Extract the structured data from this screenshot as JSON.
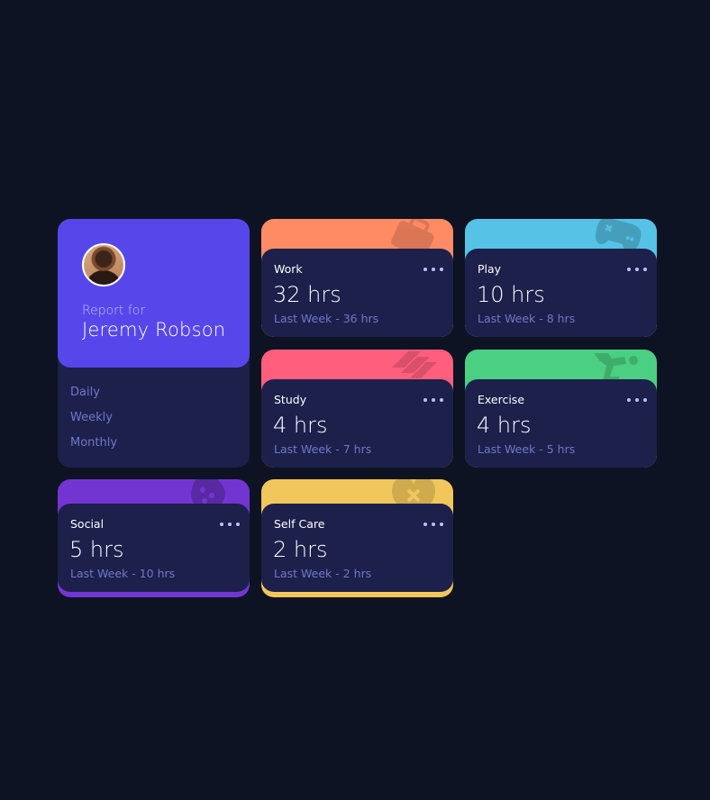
{
  "profile": {
    "report_label": "Report for",
    "name": "Jeremy Robson",
    "avatar": "user-photo"
  },
  "periods": [
    "Daily",
    "Weekly",
    "Monthly"
  ],
  "cards": [
    {
      "title": "Work",
      "hours": "32 hrs",
      "previous": "Last Week - 36 hrs",
      "color": "#ff8b64",
      "icon": "briefcase-icon"
    },
    {
      "title": "Play",
      "hours": "10 hrs",
      "previous": "Last Week - 8 hrs",
      "color": "#55c2e6",
      "icon": "game-controller-icon"
    },
    {
      "title": "Study",
      "hours": "4 hrs",
      "previous": "Last Week - 7 hrs",
      "color": "#ff5e7d",
      "icon": "books-icon"
    },
    {
      "title": "Exercise",
      "hours": "4 hrs",
      "previous": "Last Week - 5 hrs",
      "color": "#4bcf82",
      "icon": "runner-icon"
    },
    {
      "title": "Social",
      "hours": "5 hrs",
      "previous": "Last Week - 10 hrs",
      "color": "#7335d2",
      "icon": "social-icon"
    },
    {
      "title": "Self Care",
      "hours": "2 hrs",
      "previous": "Last Week - 2 hrs",
      "color": "#f1c75b",
      "icon": "heart-icon"
    }
  ]
}
